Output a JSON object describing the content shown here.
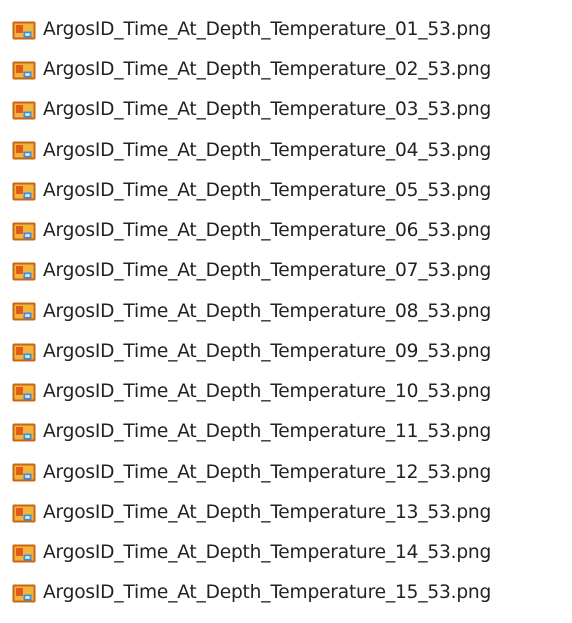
{
  "file_list": {
    "icon": "png-image-file-icon",
    "items": [
      {
        "name": "ArgosID_Time_At_Depth_Temperature_01_53.png"
      },
      {
        "name": "ArgosID_Time_At_Depth_Temperature_02_53.png"
      },
      {
        "name": "ArgosID_Time_At_Depth_Temperature_03_53.png"
      },
      {
        "name": "ArgosID_Time_At_Depth_Temperature_04_53.png"
      },
      {
        "name": "ArgosID_Time_At_Depth_Temperature_05_53.png"
      },
      {
        "name": "ArgosID_Time_At_Depth_Temperature_06_53.png"
      },
      {
        "name": "ArgosID_Time_At_Depth_Temperature_07_53.png"
      },
      {
        "name": "ArgosID_Time_At_Depth_Temperature_08_53.png"
      },
      {
        "name": "ArgosID_Time_At_Depth_Temperature_09_53.png"
      },
      {
        "name": "ArgosID_Time_At_Depth_Temperature_10_53.png"
      },
      {
        "name": "ArgosID_Time_At_Depth_Temperature_11_53.png"
      },
      {
        "name": "ArgosID_Time_At_Depth_Temperature_12_53.png"
      },
      {
        "name": "ArgosID_Time_At_Depth_Temperature_13_53.png"
      },
      {
        "name": "ArgosID_Time_At_Depth_Temperature_14_53.png"
      },
      {
        "name": "ArgosID_Time_At_Depth_Temperature_15_53.png"
      }
    ]
  },
  "colors": {
    "icon_frame": "#c8661b",
    "icon_inner": "#f2b43a",
    "icon_accent": "#3a8fd8"
  }
}
